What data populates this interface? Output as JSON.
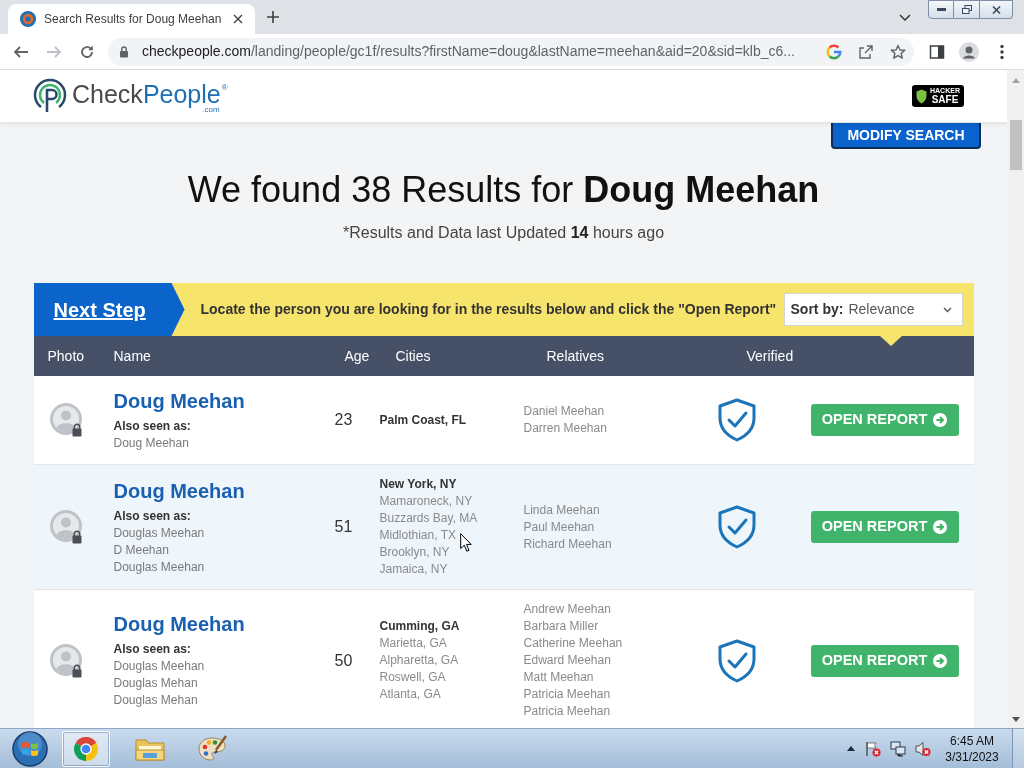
{
  "browser": {
    "tabs": [
      {
        "title": "Search Results for Doug Meehan",
        "selected": true
      }
    ],
    "back": {
      "disabled": false
    },
    "forward": {
      "disabled": true
    },
    "address": {
      "host": "checkpeople.com",
      "path": "/landing/people/gc1f/results?firstName=doug&lastName=meehan&aid=20&sid=klb_c6..."
    }
  },
  "site_header": {
    "logo": {
      "first": "Check",
      "second": "People",
      "mark": "®",
      "domain": ".com"
    },
    "badge": {
      "line_1": "HACKER",
      "line_2": "SAFE"
    }
  },
  "modify_search": "MODIFY SEARCH",
  "heading": "We found 38 Results for **Doug Meehan**",
  "updated_note": "*Results and Data last Updated **14** hours ago",
  "next_step": {
    "label": "Next Step",
    "instruction": "Locate the person you are looking for in the results below and click the \"Open Report\""
  },
  "sort": {
    "label": "Sort by:",
    "value": "Relevance"
  },
  "table": {
    "columns": [
      "Photo",
      "Name",
      "Age",
      "Cities",
      "Relatives",
      "Verified"
    ],
    "rows": [
      {
        "name": "Doug Meehan",
        "aka_label": "Also seen as:",
        "aliases": [
          "Doug Meehan"
        ],
        "age": "23",
        "cities": [
          "Palm Coast, FL"
        ],
        "relatives": [
          "Daniel Meehan",
          "Darren Meehan"
        ],
        "verified": true,
        "action": "OPEN REPORT",
        "highlighted": false
      },
      {
        "name": "Doug Meehan",
        "aka_label": "Also seen as:",
        "aliases": [
          "Douglas Meehan",
          "D Meehan",
          "Douglas Meehan"
        ],
        "age": "51",
        "cities": [
          "New York, NY",
          "Mamaroneck, NY",
          "Buzzards Bay, MA",
          "Midlothian, TX",
          "Brooklyn, NY",
          "Jamaica, NY"
        ],
        "relatives": [
          "Linda Meehan",
          "Paul Meehan",
          "Richard Meehan"
        ],
        "verified": true,
        "action": "OPEN REPORT",
        "highlighted": true
      },
      {
        "name": "Doug Meehan",
        "aka_label": "Also seen as:",
        "aliases": [
          "Douglas Meehan",
          "Douglas Mehan",
          "Douglas Mehan"
        ],
        "age": "50",
        "cities": [
          "Cumming, GA",
          "Marietta, GA",
          "Alpharetta, GA",
          "Roswell, GA",
          "Atlanta, GA"
        ],
        "relatives": [
          "Andrew Meehan",
          "Barbara Miller",
          "Catherine Meehan",
          "Edward Meehan",
          "Matt Meehan",
          "Patricia Meehan",
          "Patricia Meehan"
        ],
        "verified": true,
        "action": "OPEN REPORT",
        "highlighted": false
      }
    ]
  },
  "taskbar": {
    "apps": [
      {
        "selected": true
      },
      {
        "selected": false
      },
      {
        "selected": false
      }
    ],
    "time": "6:45 AM",
    "date": "3/31/2023"
  }
}
